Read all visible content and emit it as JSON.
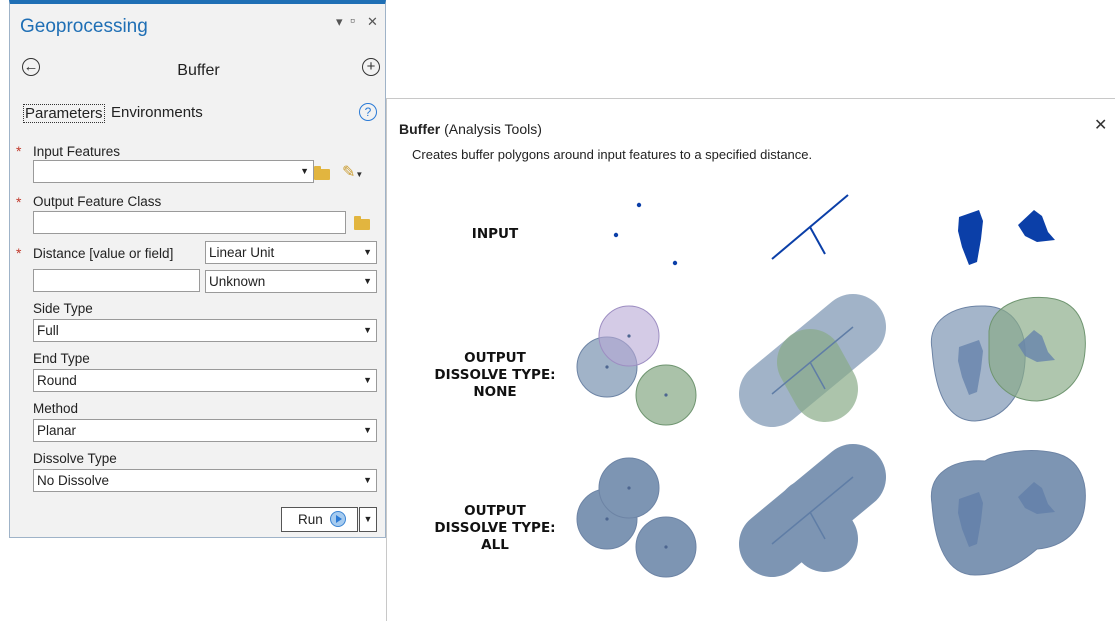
{
  "pane": {
    "title": "Geoprocessing",
    "window_controls": {
      "pin": "▾",
      "maximize": "▫",
      "close": "✕"
    },
    "back_icon": "arrow-left-icon",
    "add_icon": "plus-icon",
    "tool_name": "Buffer",
    "tabs": {
      "parameters": "Parameters",
      "environments": "Environments"
    },
    "help_symbol": "?",
    "required_marker": "*"
  },
  "params": {
    "input_features": {
      "label": "Input Features",
      "value": ""
    },
    "output_feature_class": {
      "label": "Output Feature Class",
      "value": ""
    },
    "distance": {
      "label": "Distance [value or field]",
      "value": "",
      "unit_type": "Linear Unit",
      "unit": "Unknown"
    },
    "side_type": {
      "label": "Side Type",
      "value": "Full"
    },
    "end_type": {
      "label": "End Type",
      "value": "Round"
    },
    "method": {
      "label": "Method",
      "value": "Planar"
    },
    "dissolve_type": {
      "label": "Dissolve Type",
      "value": "No Dissolve"
    }
  },
  "run": {
    "label": "Run"
  },
  "help_popup": {
    "title": "Buffer",
    "subtitle": "(Analysis Tools)",
    "description": "Creates buffer polygons around input features to a specified distance.",
    "close": "✕",
    "rows": [
      {
        "lines": [
          "INPUT"
        ]
      },
      {
        "lines": [
          "OUTPUT",
          "DISSOLVE TYPE:",
          "NONE"
        ]
      },
      {
        "lines": [
          "OUTPUT",
          "DISSOLVE TYPE:",
          "ALL"
        ]
      }
    ]
  },
  "colors": {
    "accent": "#1f6fb5",
    "required": "#c0392b",
    "input_feature": "#0b3fa8",
    "buffer_blue": "#7d95b3",
    "buffer_purple": "#b7a9d6",
    "buffer_green": "#89ab88"
  }
}
